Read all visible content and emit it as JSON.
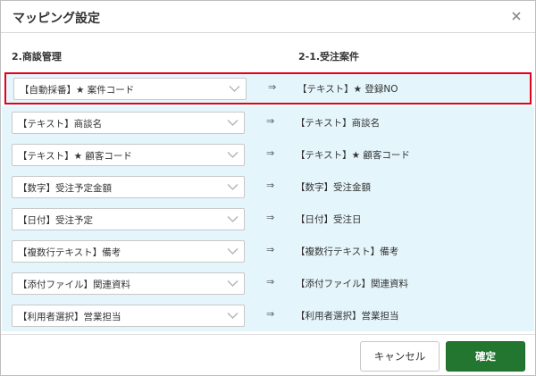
{
  "dialog": {
    "title": "マッピング設定",
    "close_icon": "close-icon"
  },
  "columns": {
    "left": "2.商談管理",
    "right": "2-1.受注案件"
  },
  "mapping_arrow": "⇒",
  "rows": [
    {
      "source": "【自動採番】★ 案件コード",
      "target": "【テキスト】★ 登録NO",
      "selected": true
    },
    {
      "source": "【テキスト】商談名",
      "target": "【テキスト】商談名"
    },
    {
      "source": "【テキスト】★ 顧客コード",
      "target": "【テキスト】★ 顧客コード"
    },
    {
      "source": "【数字】受注予定金額",
      "target": "【数字】受注金額"
    },
    {
      "source": "【日付】受注予定",
      "target": "【日付】受注日"
    },
    {
      "source": "【複数行テキスト】備考",
      "target": "【複数行テキスト】備考"
    },
    {
      "source": "【添付ファイル】関連資料",
      "target": "【添付ファイル】関連資料"
    },
    {
      "source": "【利用者選択】営業担当",
      "target": "【利用者選択】営業担当"
    }
  ],
  "footer": {
    "cancel_label": "キャンセル",
    "ok_label": "確定"
  },
  "colors": {
    "row_bg": "#e4f5fb",
    "highlight": "#e3001b",
    "primary": "#22762f"
  }
}
